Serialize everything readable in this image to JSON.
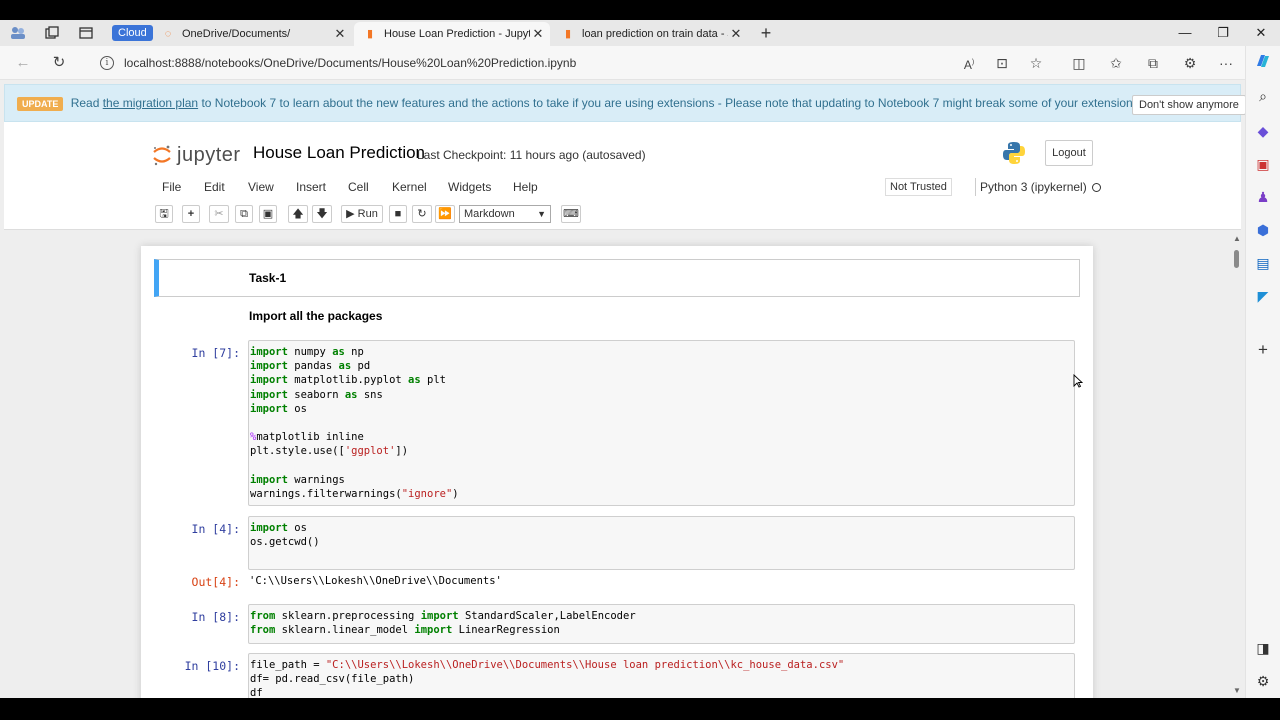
{
  "browser": {
    "cloud_badge": "Cloud",
    "tabs": [
      {
        "label": "OneDrive/Documents/",
        "active": false
      },
      {
        "label": "House Loan Prediction - Jupyter",
        "active": true
      },
      {
        "label": "loan prediction on train data - Jupyter",
        "active": false
      }
    ],
    "url": "localhost:8888/notebooks/OneDrive/Documents/House%20Loan%20Prediction.ipynb"
  },
  "banner": {
    "badge": "UPDATE",
    "text_before": "Read",
    "link": "the migration plan",
    "text_after": "to Notebook 7 to learn about the new features and the actions to take if you are using extensions - Please note that updating to Notebook 7 might break some of your extensions.",
    "dismiss": "Don't show anymore"
  },
  "header": {
    "logo_text": "jupyter",
    "title": "House Loan Prediction",
    "checkpoint": "Last Checkpoint: 11 hours ago  (autosaved)",
    "logout": "Logout"
  },
  "menu": {
    "items": [
      "File",
      "Edit",
      "View",
      "Insert",
      "Cell",
      "Kernel",
      "Widgets",
      "Help"
    ],
    "trust": "Not Trusted",
    "kernel": "Python 3 (ipykernel)"
  },
  "toolbar": {
    "run_label": "Run",
    "cell_type": "Markdown"
  },
  "cells": {
    "md1": "Task-1",
    "md2": "Import all the packages",
    "c1_prompt": "In [7]:",
    "c2_prompt": "In [4]:",
    "c2_out_prompt": "Out[4]:",
    "c2_output": "'C:\\\\Users\\\\Lokesh\\\\OneDrive\\\\Documents'",
    "c3_prompt": "In [8]:",
    "c4_prompt": "In [10]:",
    "tok": {
      "import": "import",
      "as": "as",
      "from": "from",
      "numpy": " numpy ",
      "np": " np",
      "pandas": " pandas ",
      "pd": " pd",
      "matplotlib": " matplotlib.pyplot ",
      "plt": " plt",
      "seaborn": " seaborn ",
      "sns": " sns",
      "os": " os",
      "magic": "%",
      "inline": "matplotlib inline",
      "style_pre": "plt.style.use([",
      "style_str": "'ggplot'",
      "style_post": "])",
      "warnings": " warnings",
      "filter_pre": "warnings.filterwarnings(",
      "filter_str": "\"ignore\"",
      "filter_post": ")",
      "getcwd": "os.getcwd()",
      "sk_pre": " sklearn.preprocessing ",
      "sk_post": " StandardScaler,LabelEncoder",
      "lm_pre": " sklearn.linear_model ",
      "lm_post": " LinearRegression",
      "fp_pre": "file_path = ",
      "fp_str": "\"C:\\\\Users\\\\Lokesh\\\\OneDrive\\\\Documents\\\\House loan prediction\\\\kc_house_data.csv\"",
      "readcsv": "df= pd.read_csv(file_path)",
      "df": "df"
    }
  }
}
